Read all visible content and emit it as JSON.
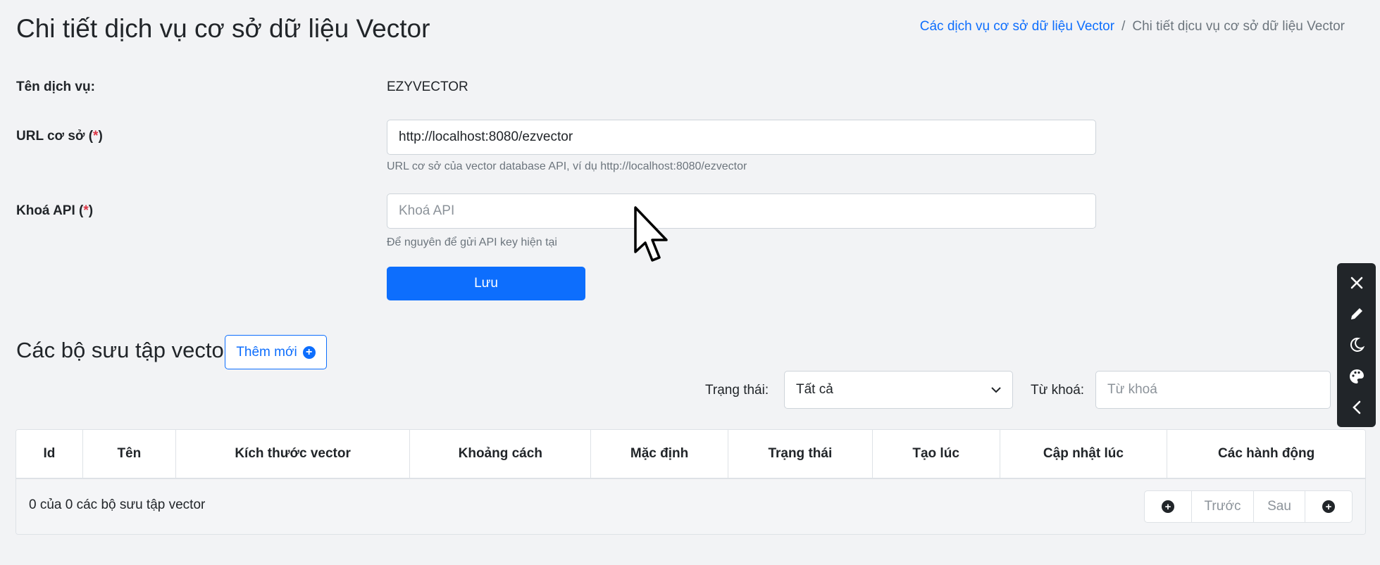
{
  "header": {
    "title": "Chi tiết dịch vụ cơ sở dữ liệu Vector",
    "breadcrumb": [
      {
        "label": "Các dịch vụ cơ sở dữ liệu Vector"
      },
      {
        "label": "Chi tiết dịcu vụ cơ sở dữ liệu Vector"
      }
    ],
    "breadcrumb_separator": "/"
  },
  "form": {
    "service_name_label": "Tên dịch vụ:",
    "service_name_value": "EZYVECTOR",
    "base_url_label": "URL cơ sở (",
    "base_url_required": "*",
    "base_url_close": ")",
    "base_url_value": "http://localhost:8080/ezvector",
    "base_url_help": "URL cơ sở của vector database API, ví dụ http://localhost:8080/ezvector",
    "api_key_label": "Khoá API (",
    "api_key_required": "*",
    "api_key_close": ")",
    "api_key_placeholder": "Khoá API",
    "api_key_help": "Để nguyên để gửi API key hiện tại",
    "save_label": "Lưu"
  },
  "collections": {
    "title": "Các bộ sưu tập vector",
    "add_label": "Thêm mới",
    "status_label": "Trạng thái:",
    "status_selected": "Tất cả",
    "keyword_label": "Từ khoá:",
    "keyword_placeholder": "Từ khoá",
    "columns": [
      "Id",
      "Tên",
      "Kích thước vector",
      "Khoảng cách",
      "Mặc định",
      "Trạng thái",
      "Tạo lúc",
      "Cập nhật lúc",
      "Các hành động"
    ],
    "count_text": "0 của 0 các bộ sưu tập vector",
    "pager": {
      "prev": "Trước",
      "next": "Sau"
    }
  },
  "toolbar": {
    "icons": [
      "close-icon",
      "pencil-icon",
      "moon-icon",
      "palette-icon",
      "chevron-left-icon"
    ]
  },
  "colors": {
    "primary": "#0d6efd",
    "required": "#dc3545",
    "toolbar_bg": "#212529",
    "page_bg": "#f2f3f5"
  }
}
